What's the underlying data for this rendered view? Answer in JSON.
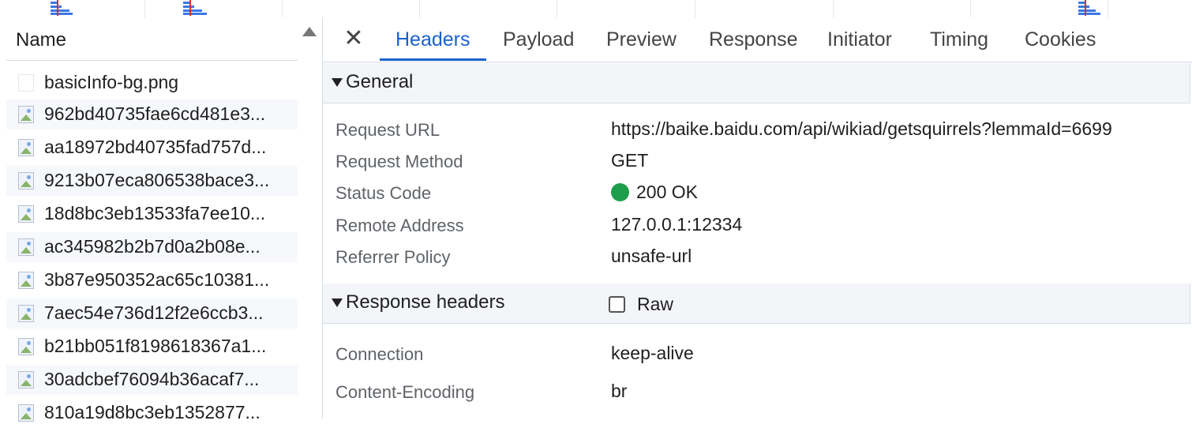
{
  "name_column": {
    "header": "Name",
    "files": [
      {
        "name": "basicInfo-bg.png",
        "icon": "blank-file-icon"
      },
      {
        "name": "962bd40735fae6cd481e3...",
        "icon": "image-icon"
      },
      {
        "name": "aa18972bd40735fad757d...",
        "icon": "image-icon"
      },
      {
        "name": "9213b07eca806538bace3...",
        "icon": "image-icon"
      },
      {
        "name": "18d8bc3eb13533fa7ee10...",
        "icon": "image-icon"
      },
      {
        "name": "ac345982b2b7d0a2b08e...",
        "icon": "image-icon"
      },
      {
        "name": "3b87e950352ac65c10381...",
        "icon": "image-icon"
      },
      {
        "name": "7aec54e736d12f2e6ccb3...",
        "icon": "image-icon"
      },
      {
        "name": "b21bb051f8198618367a1...",
        "icon": "image-icon"
      },
      {
        "name": "30adcbef76094b36acaf7...",
        "icon": "image-icon"
      },
      {
        "name": "810a19d8bc3eb1352877...",
        "icon": "image-icon"
      }
    ]
  },
  "tabs": {
    "close": "✕",
    "items": [
      "Headers",
      "Payload",
      "Preview",
      "Response",
      "Initiator",
      "Timing",
      "Cookies"
    ],
    "active": "Headers"
  },
  "general": {
    "title": "General",
    "request_url_label": "Request URL",
    "request_url": "https://baike.baidu.com/api/wikiad/getsquirrels?lemmaId=6699",
    "request_method_label": "Request Method",
    "request_method": "GET",
    "status_code_label": "Status Code",
    "status_code": "200 OK",
    "status_color": "#1e9e4a",
    "remote_address_label": "Remote Address",
    "remote_address": "127.0.0.1:12334",
    "referrer_policy_label": "Referrer Policy",
    "referrer_policy": "unsafe-url"
  },
  "response_headers": {
    "title": "Response headers",
    "raw_label": "Raw",
    "raw_checked": false,
    "connection_label": "Connection",
    "connection": "keep-alive",
    "content_encoding_label": "Content-Encoding",
    "content_encoding": "br"
  },
  "colors": {
    "accent": "#1a62cf",
    "waterfall_bar": "#3b78e7",
    "waterfall_marker": "#d93025"
  }
}
